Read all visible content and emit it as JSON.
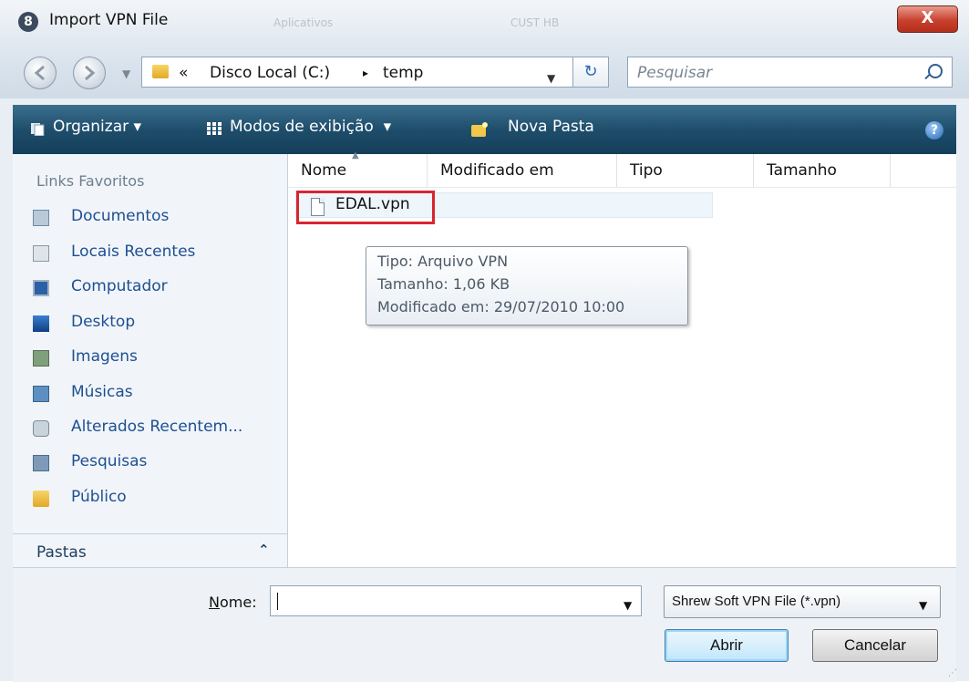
{
  "window": {
    "title": "Import VPN File",
    "close_label": "X",
    "background_titles": [
      "Aplicativos",
      "CUST HB"
    ]
  },
  "address": {
    "overflow": "«",
    "crumbs": [
      "Disco Local (C:)",
      "temp"
    ],
    "separator": "▸",
    "search_placeholder": "Pesquisar"
  },
  "toolbar": {
    "organize": "Organizar",
    "views": "Modos de exibição",
    "new_folder": "Nova Pasta",
    "help": "?",
    "color": "#1e4e6c"
  },
  "sidebar": {
    "title": "Links Favoritos",
    "items": [
      {
        "label": "Documentos",
        "icon": "documents-icon"
      },
      {
        "label": "Locais Recentes",
        "icon": "recent-places-icon"
      },
      {
        "label": "Computador",
        "icon": "computer-icon"
      },
      {
        "label": "Desktop",
        "icon": "desktop-icon"
      },
      {
        "label": "Imagens",
        "icon": "pictures-icon"
      },
      {
        "label": "Músicas",
        "icon": "music-icon"
      },
      {
        "label": "Alterados Recentem...",
        "icon": "recently-changed-icon"
      },
      {
        "label": "Pesquisas",
        "icon": "searches-icon"
      },
      {
        "label": "Público",
        "icon": "public-folder-icon"
      }
    ],
    "folders_label": "Pastas"
  },
  "files": {
    "columns": [
      "Nome",
      "Modificado em",
      "Tipo",
      "Tamanho"
    ],
    "items": [
      {
        "name": "EDAL.vpn"
      }
    ],
    "tooltip": {
      "type": "Tipo: Arquivo VPN",
      "size": "Tamanho: 1,06 KB",
      "modified": "Modificado em: 29/07/2010 10:00"
    },
    "highlight_color": "#d8262e"
  },
  "footer": {
    "name_label_first": "N",
    "name_label_rest": "ome:",
    "name_value": "",
    "filter": "Shrew Soft VPN File (*.vpn)",
    "open": "Abrir",
    "cancel": "Cancelar"
  }
}
